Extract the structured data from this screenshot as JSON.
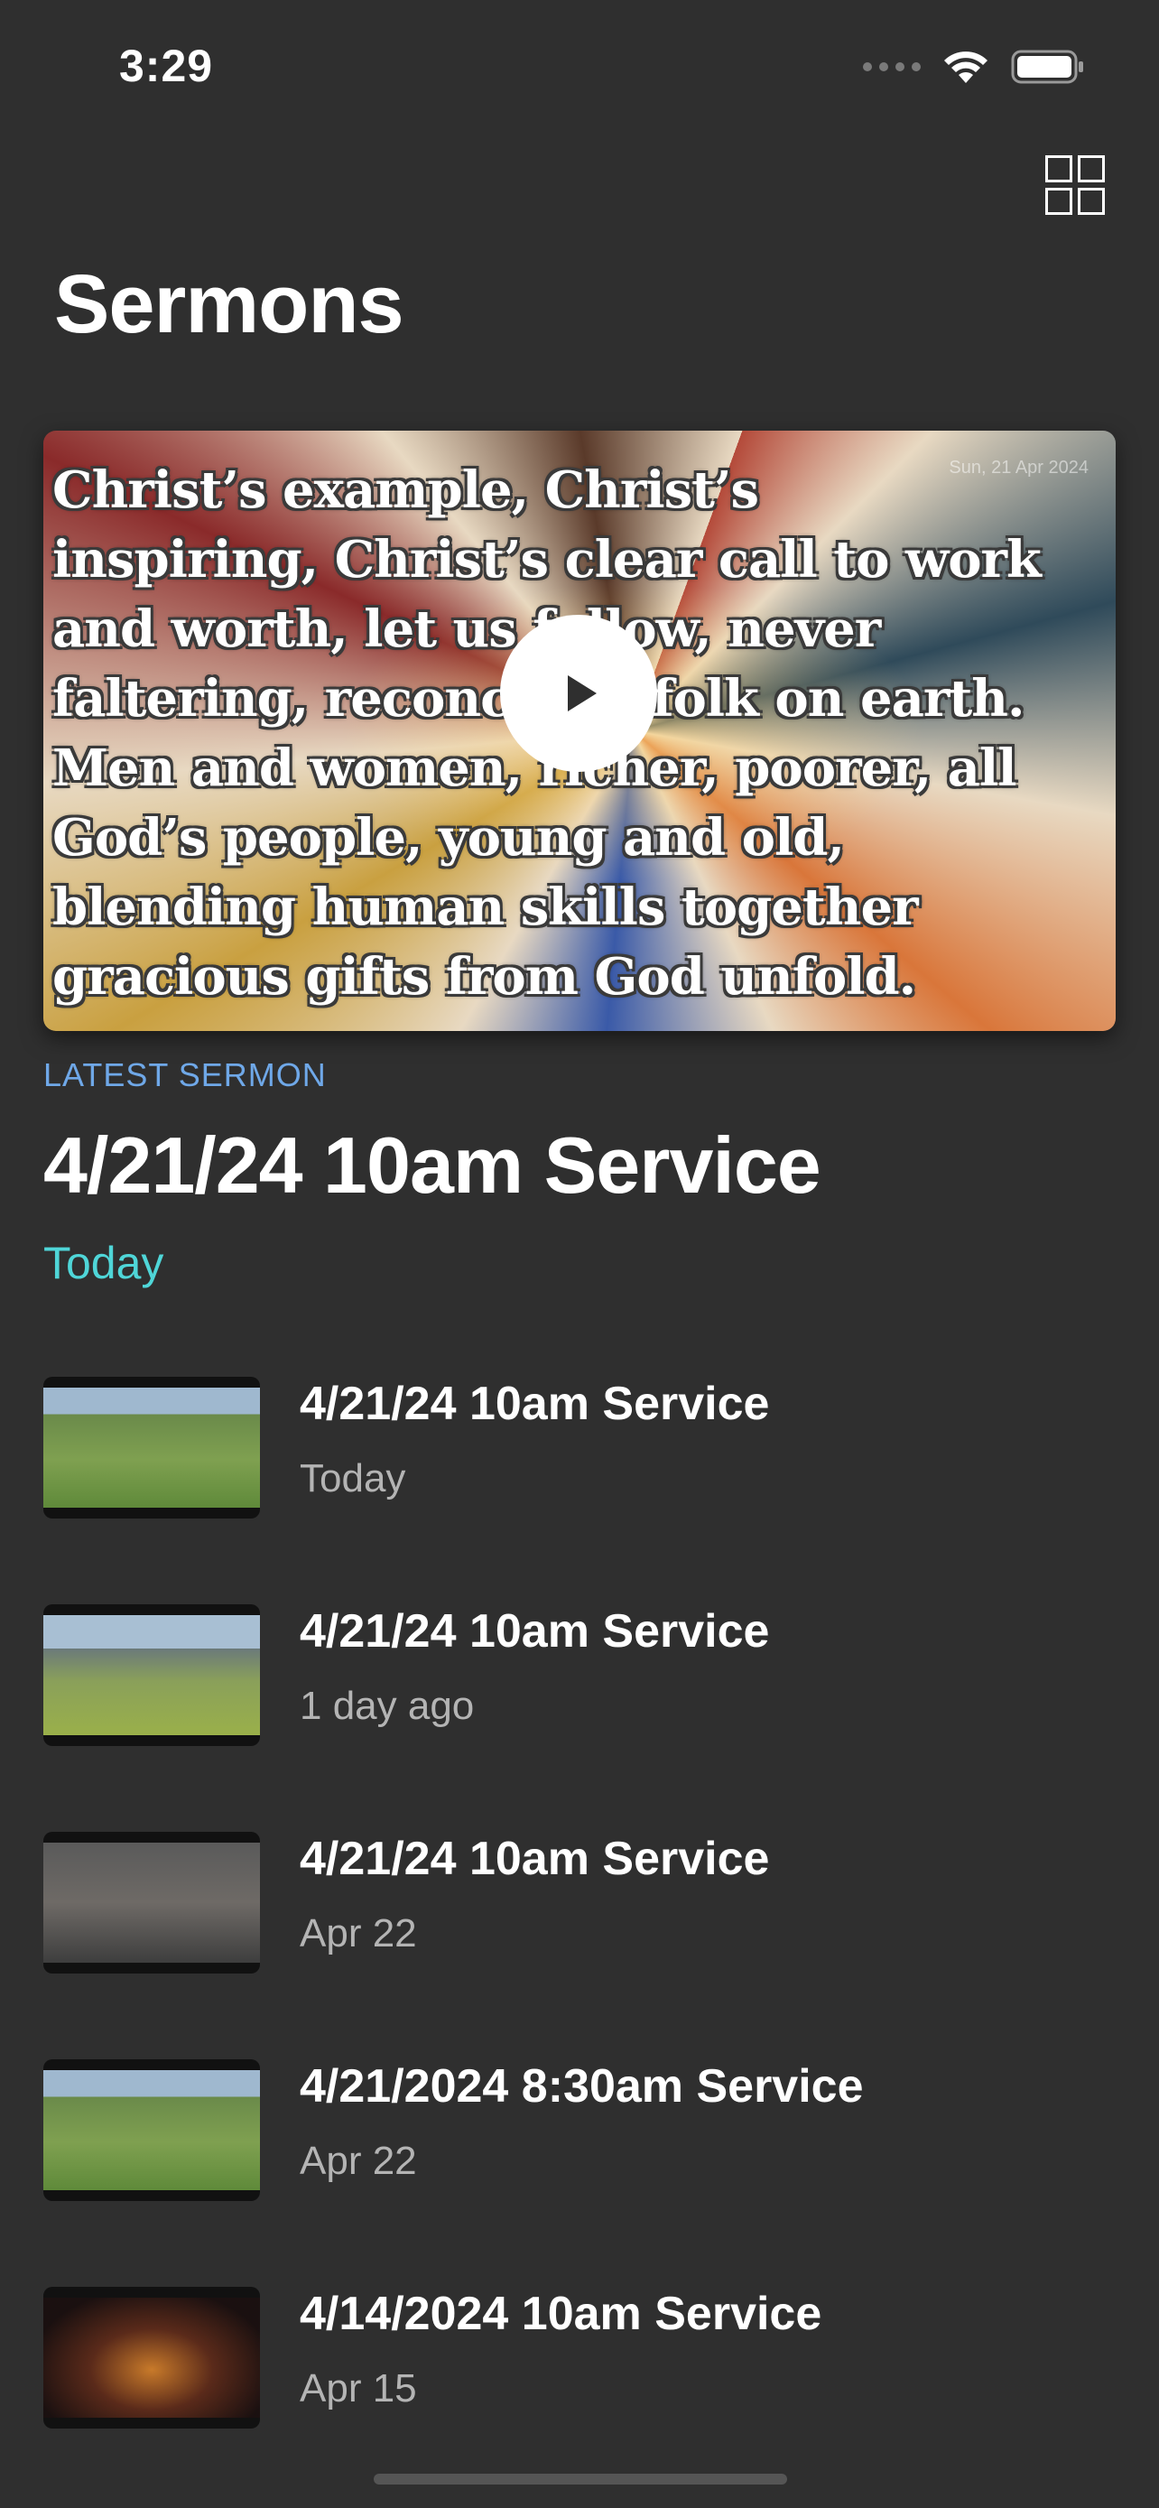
{
  "status_bar": {
    "time": "3:29"
  },
  "header": {
    "title": "Sermons"
  },
  "featured": {
    "overlay_text": "Christ’s example, Christ’s\ninspiring, Christ’s clear call to work\nand worth, let us follow, never\nfaltering, reconciling folk on earth.\nMen and women, richer, poorer, all\nGod’s people, young and old,\nblending human skills together\ngracious gifts from God unfold.",
    "overlay_date": "Sun, 21 Apr 2024",
    "label": "LATEST SERMON",
    "title": "4/21/24 10am Service",
    "date": "Today"
  },
  "sermons": [
    {
      "title": "4/21/24 10am Service",
      "date": "Today",
      "thumb": "field"
    },
    {
      "title": "4/21/24 10am Service",
      "date": "1 day ago",
      "thumb": "field2"
    },
    {
      "title": "4/21/24 10am Service",
      "date": "Apr 22",
      "thumb": "room"
    },
    {
      "title": "4/21/2024 8:30am Service",
      "date": "Apr 22",
      "thumb": "field"
    },
    {
      "title": "4/14/2024 10am Service",
      "date": "Apr 15",
      "thumb": "dark"
    }
  ],
  "colors": {
    "background": "#2f2f2f",
    "label_blue": "#6fa8e8",
    "date_cyan": "#4fd6d8",
    "secondary_text": "#b4b4b4"
  },
  "icons": {
    "grid": "grid-icon",
    "play": "play-icon",
    "wifi": "wifi-icon",
    "battery": "battery-icon",
    "signal": "signal-icon"
  }
}
